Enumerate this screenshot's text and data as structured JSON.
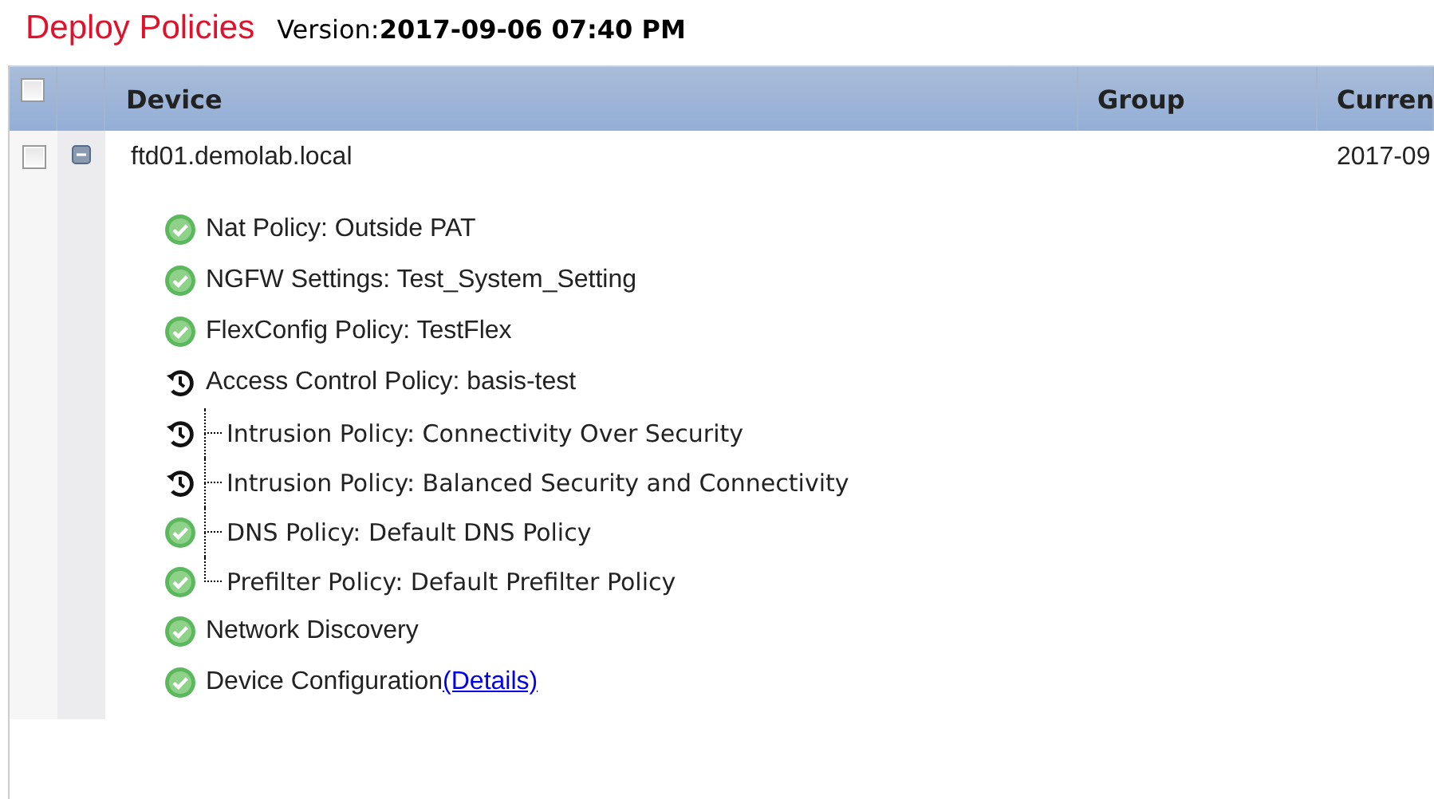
{
  "title": "Deploy Policies",
  "version_label": "Version:",
  "version_value": "2017-09-06 07:40 PM",
  "table": {
    "select_all": {
      "checked": false
    },
    "columns": [
      "Device",
      "Group",
      "Curren"
    ],
    "rows": [
      {
        "checked": false,
        "expanded": true,
        "device": "ftd01.demolab.local",
        "current": "2017-09",
        "policies": [
          {
            "label": "Nat Policy: Outside PAT",
            "kind": "ok"
          },
          {
            "label": "NGFW Settings: Test_System_Setting",
            "kind": "ok"
          },
          {
            "label": "FlexConfig Policy: TestFlex",
            "kind": "ok"
          },
          {
            "label": "Access Control Policy: basis-test",
            "kind": "pending",
            "children": [
              {
                "label": "Intrusion Policy: Connectivity Over Security",
                "kind": "pending"
              },
              {
                "label": "Intrusion Policy: Balanced Security and Connectivity",
                "kind": "pending"
              },
              {
                "label": "DNS Policy: Default DNS Policy",
                "kind": "ok"
              },
              {
                "label": "Prefilter Policy: Default Prefilter Policy",
                "kind": "ok"
              }
            ]
          },
          {
            "label": "Network Discovery",
            "kind": "ok"
          },
          {
            "label": "Device Configuration",
            "kind": "ok",
            "link": "(Details)"
          }
        ]
      }
    ]
  }
}
